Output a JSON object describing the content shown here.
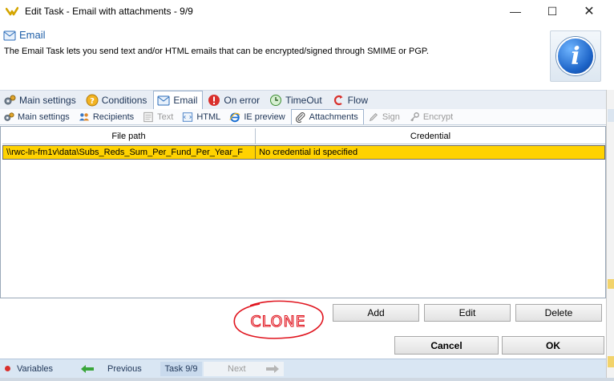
{
  "window": {
    "title": "Edit Task - Email with attachments - 9/9",
    "controls": {
      "minimize": "—",
      "maximize": "☐",
      "close": "✕"
    }
  },
  "header": {
    "task_name": "Email",
    "description": "The Email Task lets you send text and/or HTML emails that can be encrypted/signed through SMIME or PGP.",
    "info_icon": "i"
  },
  "main_tabs": [
    {
      "label": "Main settings",
      "icon": "gears-icon"
    },
    {
      "label": "Conditions",
      "icon": "conditions-icon"
    },
    {
      "label": "Email",
      "icon": "email-task-icon",
      "active": true
    },
    {
      "label": "On error",
      "icon": "error-icon"
    },
    {
      "label": "TimeOut",
      "icon": "timeout-icon"
    },
    {
      "label": "Flow",
      "icon": "flow-icon"
    }
  ],
  "sub_tabs": [
    {
      "label": "Main settings",
      "icon": "gears-icon"
    },
    {
      "label": "Recipients",
      "icon": "recipients-icon"
    },
    {
      "label": "Text",
      "icon": "text-icon",
      "disabled": true
    },
    {
      "label": "HTML",
      "icon": "html-icon"
    },
    {
      "label": "IE preview",
      "icon": "ie-icon"
    },
    {
      "label": "Attachments",
      "icon": "paperclip-icon",
      "active": true
    },
    {
      "label": "Sign",
      "icon": "pen-icon",
      "disabled": true
    },
    {
      "label": "Encrypt",
      "icon": "key-icon",
      "disabled": true
    }
  ],
  "attachments_grid": {
    "columns": [
      "File path",
      "Credential"
    ],
    "rows": [
      {
        "file_path": "\\\\rwc-ln-fm1v\\data\\Subs_Reds_Sum_Per_Fund_Per_Year_F",
        "credential": "No credential id specified"
      }
    ]
  },
  "actions": {
    "add": "Add",
    "edit": "Edit",
    "delete": "Delete"
  },
  "annotation": "CLONE",
  "dialog_buttons": {
    "cancel": "Cancel",
    "ok": "OK"
  },
  "footer": {
    "variables": "Variables",
    "previous": "Previous",
    "position": "Task 9/9",
    "next": "Next"
  },
  "colors": {
    "selected_row": "#ffd200",
    "tab_text": "#1e3557",
    "annotation_ink": "#e0141e"
  }
}
